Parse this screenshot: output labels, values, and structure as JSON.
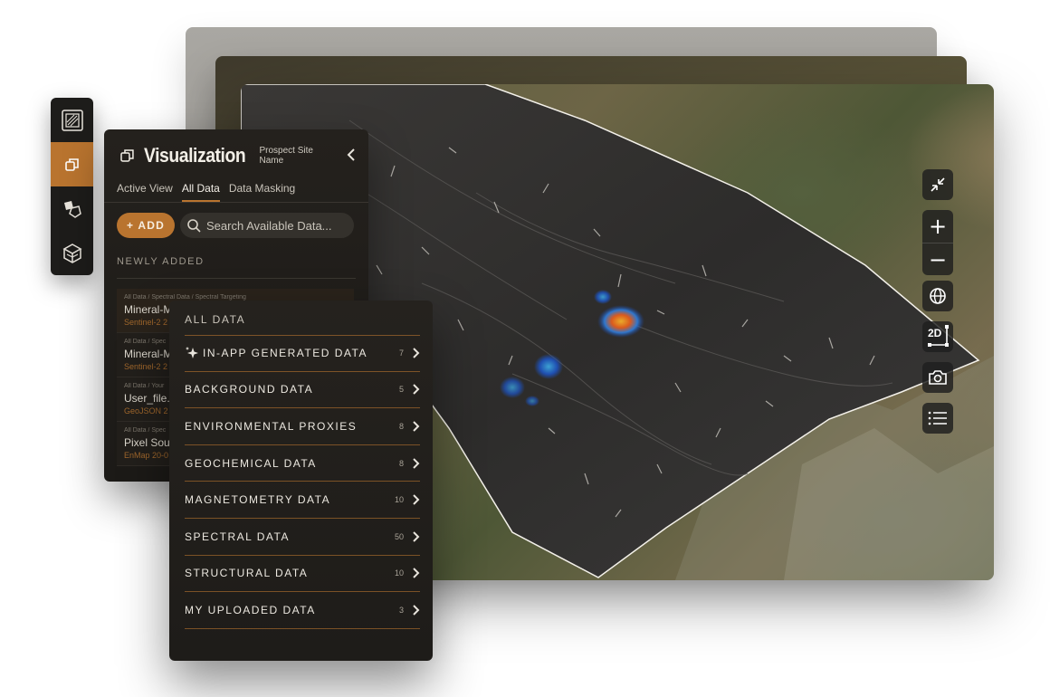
{
  "icon_rail": {
    "items": [
      {
        "name": "map-layers",
        "icon": "map-frame-icon",
        "active": false
      },
      {
        "name": "visualization",
        "icon": "window-restore-icon",
        "active": true
      },
      {
        "name": "shapes",
        "icon": "shapes-icon",
        "active": false
      },
      {
        "name": "3d-layers",
        "icon": "cube-stack-icon",
        "active": false
      }
    ]
  },
  "visualization_panel": {
    "title": "Visualization",
    "site_name": "Prospect Site Name",
    "tabs": [
      {
        "label": "Active View",
        "active": false
      },
      {
        "label": "All Data",
        "active": true
      },
      {
        "label": "Data Masking",
        "active": false
      }
    ],
    "add_label": "+ ADD",
    "search_placeholder": "Search Available Data...",
    "section_label": "NEWLY ADDED",
    "recent_items": [
      {
        "path": "All Data / Spectral Data / Spectral Targeting",
        "name": "Mineral-M",
        "sub": "Sentinel-2 2"
      },
      {
        "path": "All Data / Spec",
        "name": "Mineral-M",
        "sub": "Sentinel-2 2"
      },
      {
        "path": "All Data / Your",
        "name": "User_file.",
        "sub": "GeoJSON 2"
      },
      {
        "path": "All Data / Spec",
        "name": "Pixel Sour",
        "sub": "EnMap 20-0"
      }
    ]
  },
  "all_data_menu": {
    "title": "ALL DATA",
    "categories": [
      {
        "label": "IN-APP GENERATED DATA",
        "count": "7",
        "icon": "sparkle-icon"
      },
      {
        "label": "BACKGROUND DATA",
        "count": "5"
      },
      {
        "label": "ENVIRONMENTAL PROXIES",
        "count": "8"
      },
      {
        "label": "GEOCHEMICAL DATA",
        "count": "8"
      },
      {
        "label": "MAGNETOMETRY DATA",
        "count": "10"
      },
      {
        "label": "SPECTRAL DATA",
        "count": "50"
      },
      {
        "label": "STRUCTURAL DATA",
        "count": "10"
      },
      {
        "label": "MY UPLOADED DATA",
        "count": "3"
      }
    ]
  },
  "map_controls": {
    "toggle_2d_label": "2D",
    "icons": [
      "collapse-icon",
      "zoom-in-icon",
      "zoom-out-icon",
      "globe-icon",
      "toggle-2d-icon",
      "camera-icon",
      "list-icon"
    ]
  },
  "colors": {
    "accent": "#b9742f",
    "panel_bg": "#211f1b",
    "rail_bg": "#1d1c1a"
  }
}
